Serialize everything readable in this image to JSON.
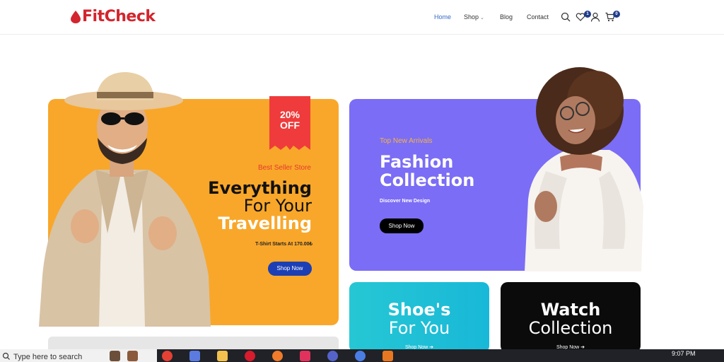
{
  "header": {
    "logo": "FitCheck",
    "nav": {
      "home": "Home",
      "shop": "Shop",
      "blog": "Blog",
      "contact": "Contact"
    },
    "wishlist_count": "1",
    "cart_count": "0",
    "accent": "#d3252e"
  },
  "banners": {
    "travel": {
      "badge_percent": "20%",
      "badge_off": "OFF",
      "tag": "Best Seller Store",
      "line1": "Everything",
      "line2": "For Your",
      "line3": "Travelling",
      "sub": "T-Shirt Starts At 170.00₺",
      "button": "Shop Now",
      "color": "#f9a72a"
    },
    "fashion": {
      "tag": "Top New Arrivals",
      "title": "Fashion Collection",
      "sub": "Discover New Design",
      "button": "Shop Now",
      "color": "#7b6df5"
    },
    "shoes": {
      "line1": "Shoe's",
      "line2": "For You",
      "link": "Shop Now ➔"
    },
    "watch": {
      "line1": "Watch",
      "line2": "Collection",
      "link": "Shop Now ➔"
    }
  },
  "taskbar": {
    "search_placeholder": "Type here to search",
    "time": "9:07 PM"
  }
}
